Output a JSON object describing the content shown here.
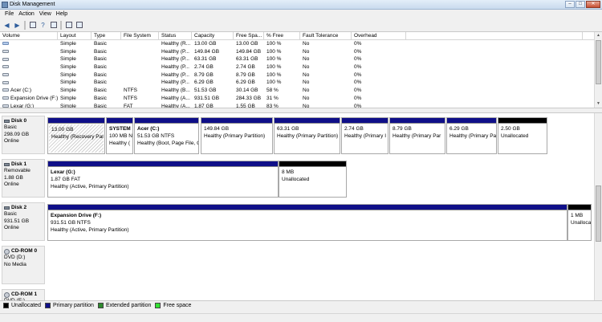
{
  "window": {
    "title": "Disk Management"
  },
  "menu": [
    "File",
    "Action",
    "View",
    "Help"
  ],
  "volumes": {
    "columns": [
      "Volume",
      "Layout",
      "Type",
      "File System",
      "Status",
      "Capacity",
      "Free Spa...",
      "% Free",
      "Fault Tolerance",
      "Overhead"
    ],
    "rows": [
      [
        "",
        "Simple",
        "Basic",
        "",
        "Healthy (R...",
        "13.00 GB",
        "13.00 GB",
        "100 %",
        "No",
        "0%"
      ],
      [
        "",
        "Simple",
        "Basic",
        "",
        "Healthy (P...",
        "149.84 GB",
        "149.84 GB",
        "100 %",
        "No",
        "0%"
      ],
      [
        "",
        "Simple",
        "Basic",
        "",
        "Healthy (P...",
        "63.31 GB",
        "63.31 GB",
        "100 %",
        "No",
        "0%"
      ],
      [
        "",
        "Simple",
        "Basic",
        "",
        "Healthy (P...",
        "2.74 GB",
        "2.74 GB",
        "100 %",
        "No",
        "0%"
      ],
      [
        "",
        "Simple",
        "Basic",
        "",
        "Healthy (P...",
        "8.79 GB",
        "8.79 GB",
        "100 %",
        "No",
        "0%"
      ],
      [
        "",
        "Simple",
        "Basic",
        "",
        "Healthy (P...",
        "6.29 GB",
        "6.29 GB",
        "100 %",
        "No",
        "0%"
      ],
      [
        "Acer (C:)",
        "Simple",
        "Basic",
        "NTFS",
        "Healthy (B...",
        "51.53 GB",
        "30.14 GB",
        "58 %",
        "No",
        "0%"
      ],
      [
        "Expansion Drive (F:)",
        "Simple",
        "Basic",
        "NTFS",
        "Healthy (A...",
        "931.51 GB",
        "284.33 GB",
        "31 %",
        "No",
        "0%"
      ],
      [
        "Lexar (G:)",
        "Simple",
        "Basic",
        "FAT",
        "Healthy (A...",
        "1.87 GB",
        "1.55 GB",
        "83 %",
        "No",
        "0%"
      ]
    ]
  },
  "disks": [
    {
      "name": "Disk 0",
      "type": "Basic",
      "size": "298.09 GB",
      "state": "Online",
      "media": "",
      "partitions": [
        {
          "name": "",
          "size": "13.00 GB",
          "status": "Healthy (Recovery Par"
        },
        {
          "name": "SYSTEM",
          "size": "100 MB N",
          "status": "Healthy ("
        },
        {
          "name": "Acer  (C:)",
          "size": "51.53 GB NTFS",
          "status": "Healthy (Boot, Page File, C"
        },
        {
          "name": "",
          "size": "149.84 GB",
          "status": "Healthy (Primary Partition)"
        },
        {
          "name": "",
          "size": "63.31 GB",
          "status": "Healthy (Primary Partition)"
        },
        {
          "name": "",
          "size": "2.74 GB",
          "status": "Healthy (Primary I"
        },
        {
          "name": "",
          "size": "8.79 GB",
          "status": "Healthy (Primary Par"
        },
        {
          "name": "",
          "size": "6.29 GB",
          "status": "Healthy (Primary Pa"
        },
        {
          "name": "",
          "size": "2.50 GB",
          "status": "Unallocated"
        }
      ]
    },
    {
      "name": "Disk 1",
      "type": "Removable",
      "size": "1.88 GB",
      "state": "Online",
      "media": "",
      "partitions": [
        {
          "name": "Lexar  (G:)",
          "size": "1.87 GB FAT",
          "status": "Healthy (Active, Primary Partition)"
        },
        {
          "name": "",
          "size": "8 MB",
          "status": "Unallocated"
        }
      ]
    },
    {
      "name": "Disk 2",
      "type": "Basic",
      "size": "931.51 GB",
      "state": "Online",
      "media": "",
      "partitions": [
        {
          "name": "Expansion Drive  (F:)",
          "size": "931.51 GB NTFS",
          "status": "Healthy (Active, Primary Partition)"
        },
        {
          "name": "",
          "size": "1 MB",
          "status": "Unalloca"
        }
      ]
    },
    {
      "name": "CD-ROM 0",
      "type": "DVD (D:)",
      "size": "",
      "state": "",
      "media": "No Media",
      "partitions": []
    },
    {
      "name": "CD-ROM 1",
      "type": "DVD (E:)",
      "size": "",
      "state": "",
      "media": "",
      "partitions": []
    }
  ],
  "legend": [
    {
      "label": "Unallocated",
      "color": "#000000"
    },
    {
      "label": "Primary partition",
      "color": "#0f0f88"
    },
    {
      "label": "Extended partition",
      "color": "#2e8b2e"
    },
    {
      "label": "Free space",
      "color": "#33e233"
    }
  ],
  "colors": {
    "primary": "#0f0f88",
    "unallocated": "#000000"
  }
}
